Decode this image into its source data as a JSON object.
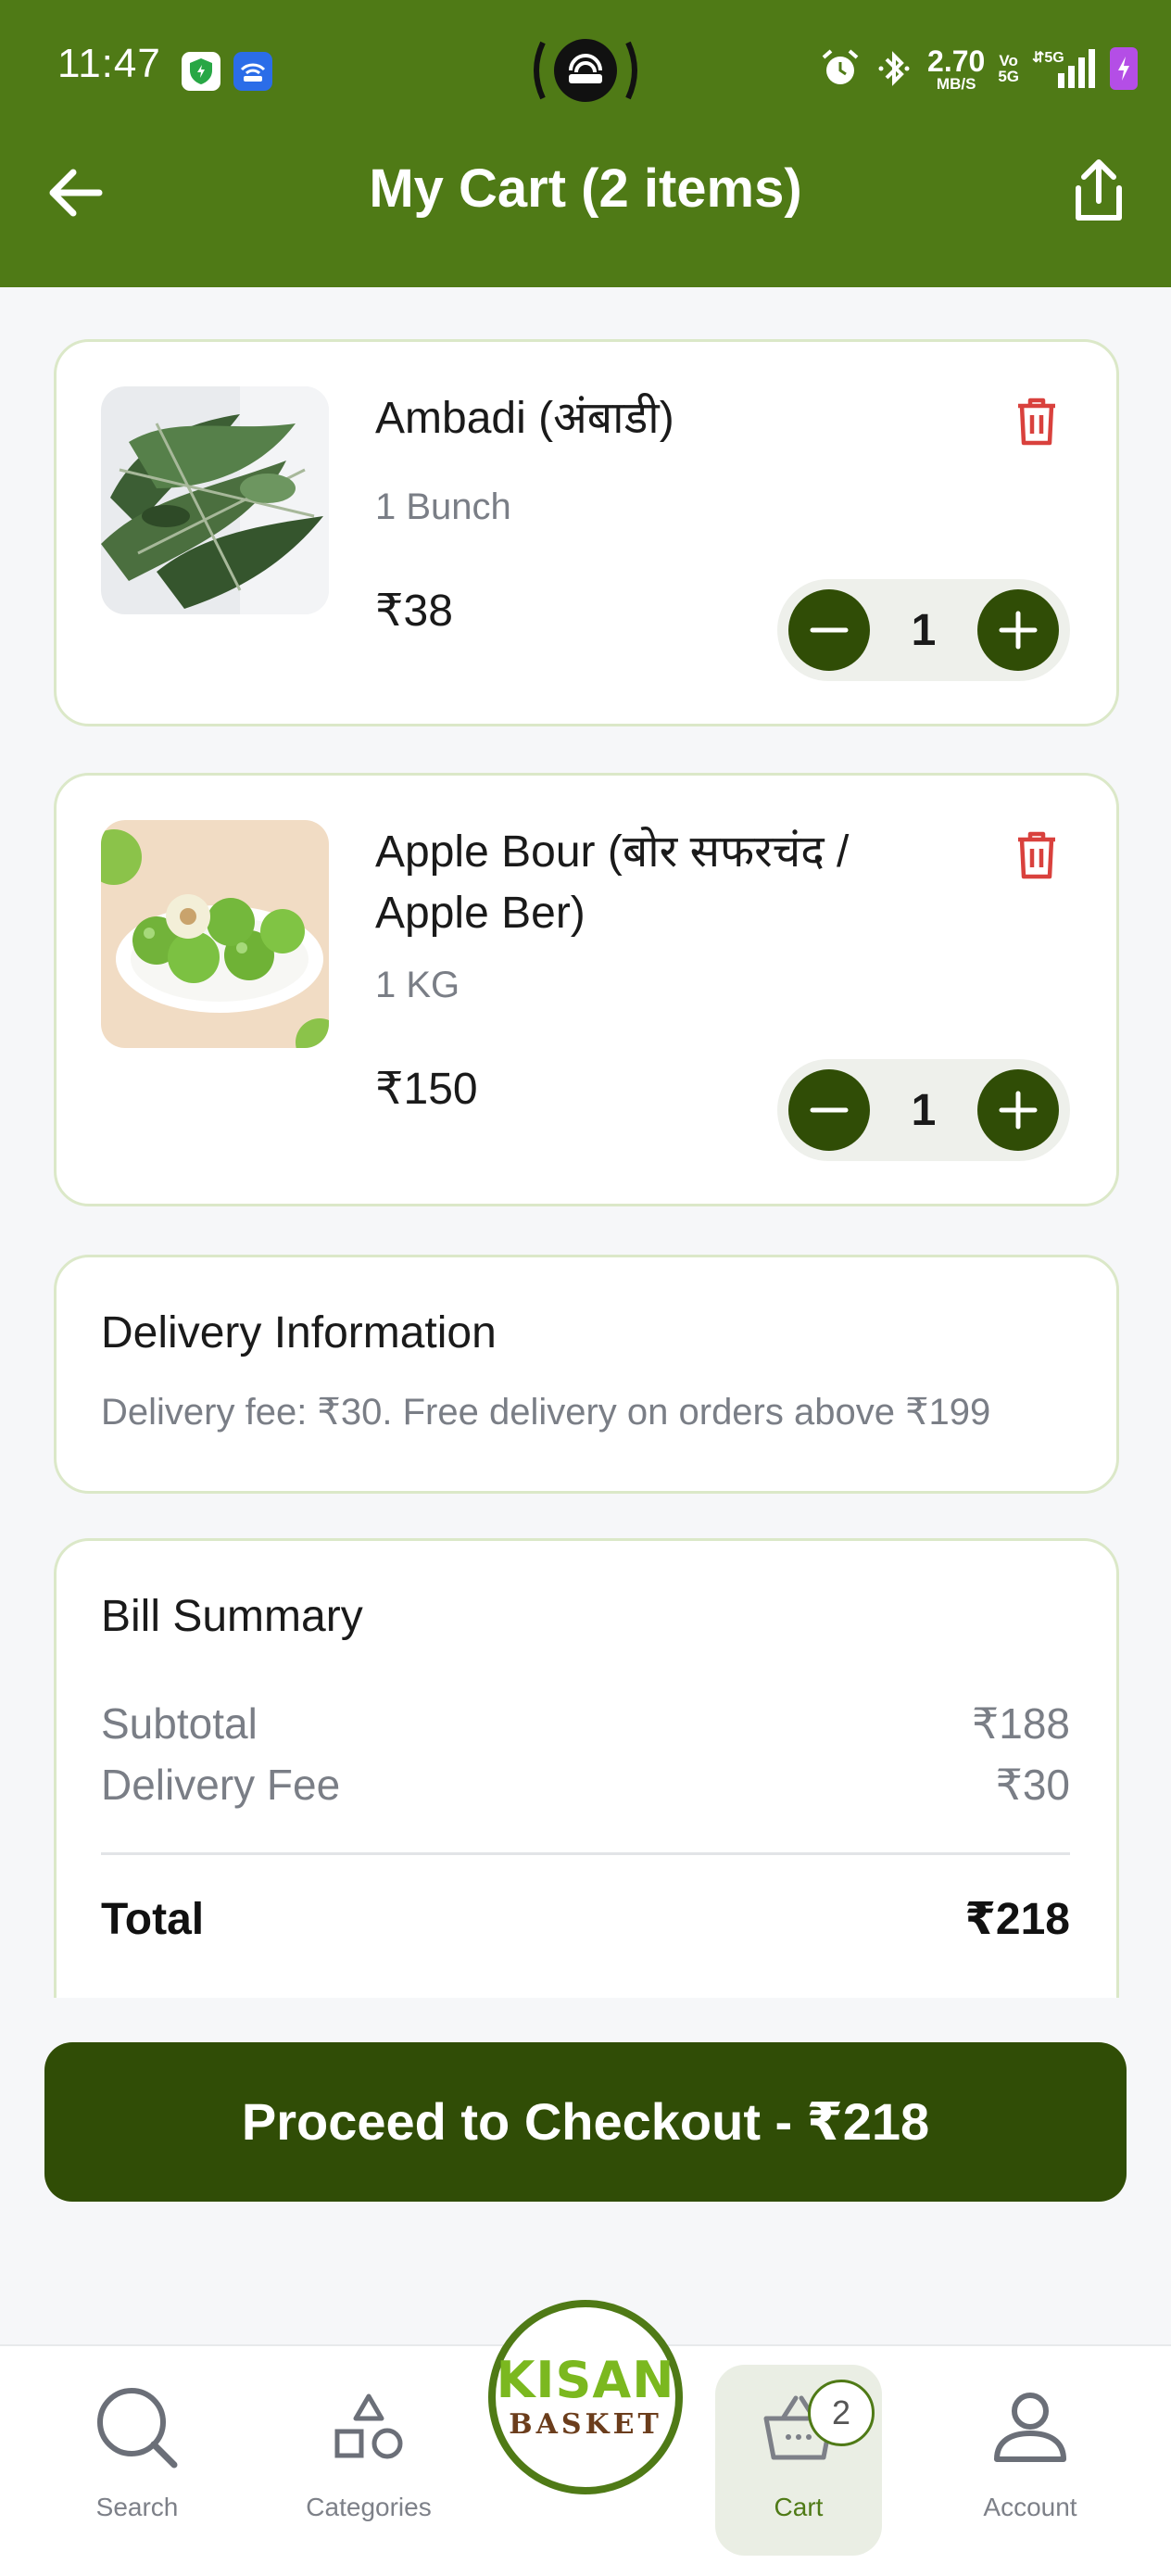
{
  "status_bar": {
    "time": "11:47",
    "net_speed": "2.70",
    "net_unit": "MB/S",
    "volte_top": "Vo",
    "volte_bottom": "5G",
    "network": "5G"
  },
  "header": {
    "title": "My Cart (2 items)",
    "back_icon": "arrow-left-icon",
    "share_icon": "share-icon"
  },
  "cart": {
    "items": [
      {
        "name": "Ambadi (अंबाडी)",
        "unit": "1 Bunch",
        "price": "₹38",
        "quantity": "1",
        "image": "leafy-greens-bunch"
      },
      {
        "name": "Apple Bour (बोर सफरचंद / Apple Ber)",
        "unit": "1 KG",
        "price": "₹150",
        "quantity": "1",
        "image": "green-apple-ber-plate"
      }
    ]
  },
  "delivery_info": {
    "heading": "Delivery Information",
    "text": "Delivery fee: ₹30. Free delivery on orders above ₹199"
  },
  "bill_summary": {
    "heading": "Bill Summary",
    "subtotal_label": "Subtotal",
    "subtotal_value": "₹188",
    "delivery_label": "Delivery Fee",
    "delivery_value": "₹30",
    "total_label": "Total",
    "total_value": "₹218"
  },
  "checkout": {
    "label": "Proceed to Checkout - ₹218"
  },
  "bottom_nav": {
    "items": [
      {
        "label": "Search",
        "icon": "search-icon"
      },
      {
        "label": "Categories",
        "icon": "shapes-icon"
      },
      {
        "label": "Cart",
        "icon": "basket-icon",
        "badge": "2",
        "active": true
      },
      {
        "label": "Account",
        "icon": "person-icon"
      }
    ],
    "logo_line1": "KISAN",
    "logo_line2": "BASKET"
  },
  "colors": {
    "brand_green": "#4f7a16",
    "dark_green": "#304d06",
    "delete_red": "#d9413d",
    "muted_text": "#7a7e86"
  }
}
